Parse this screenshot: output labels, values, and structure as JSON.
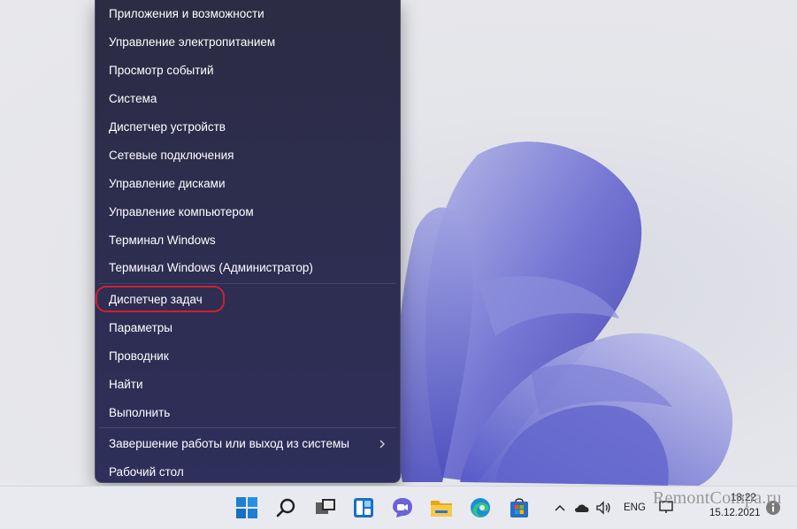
{
  "context_menu": {
    "items": [
      {
        "label": "Приложения и возможности"
      },
      {
        "label": "Управление электропитанием"
      },
      {
        "label": "Просмотр событий"
      },
      {
        "label": "Система"
      },
      {
        "label": "Диспетчер устройств"
      },
      {
        "label": "Сетевые подключения"
      },
      {
        "label": "Управление дисками"
      },
      {
        "label": "Управление компьютером"
      },
      {
        "label": "Терминал Windows"
      },
      {
        "label": "Терминал Windows (Администратор)"
      },
      {
        "label": "Диспетчер задач",
        "highlighted": true
      },
      {
        "label": "Параметры"
      },
      {
        "label": "Проводник"
      },
      {
        "label": "Найти"
      },
      {
        "label": "Выполнить"
      },
      {
        "label": "Завершение работы или выход из системы",
        "has_submenu": true
      },
      {
        "label": "Рабочий стол"
      }
    ],
    "submenu_icon": "chevron-right-icon",
    "highlight_color": "#d0202c"
  },
  "taskbar": {
    "icons": [
      "windows-start-icon",
      "search-icon",
      "task-view-icon",
      "widgets-icon",
      "teams-chat-icon",
      "file-explorer-icon",
      "edge-browser-icon",
      "microsoft-store-icon"
    ],
    "tray": {
      "chevron_icon": "chevron-up-icon",
      "language": "ENG",
      "time": "18:22",
      "date": "15.12.2021"
    }
  },
  "watermark": "RemontCompa.ru"
}
